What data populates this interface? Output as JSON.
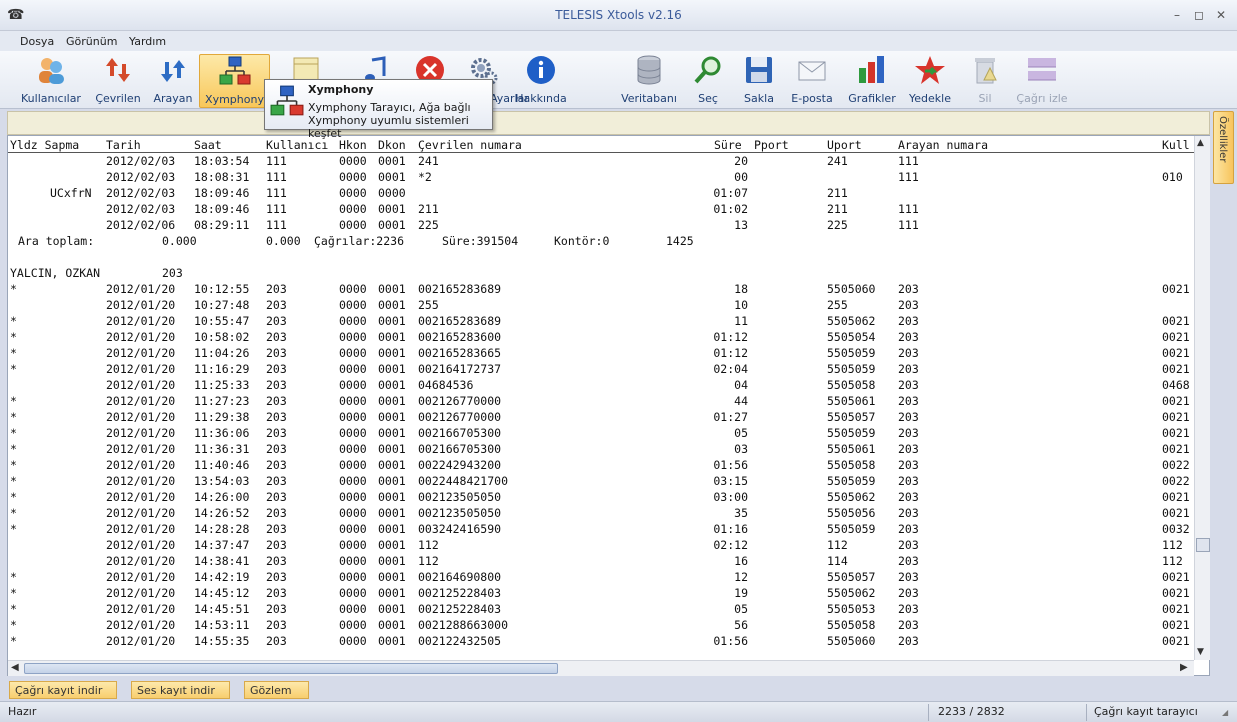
{
  "window": {
    "title": "TELESIS Xtools v2.16",
    "minimize": "–",
    "maximize": "◻",
    "close": "✕"
  },
  "menu": [
    "Dosya",
    "Görünüm",
    "Yardım"
  ],
  "toolbar": {
    "buttons": [
      {
        "label": "Kullanıcılar",
        "icon": "users-icon"
      },
      {
        "label": "Çevrilen",
        "icon": "dialed-arrows-icon"
      },
      {
        "label": "Arayan",
        "icon": "caller-arrows-icon"
      },
      {
        "label": "Xymphony",
        "icon": "network-tree-icon"
      },
      {
        "label": "Ayarlar",
        "icon": "gear-icon"
      },
      {
        "label": "Hakkında",
        "icon": "info-icon"
      },
      {
        "label": "Veritabanı",
        "icon": "database-icon"
      },
      {
        "label": "Seç",
        "icon": "magnifier-icon"
      },
      {
        "label": "Sakla",
        "icon": "floppy-icon"
      },
      {
        "label": "E-posta",
        "icon": "email-icon"
      },
      {
        "label": "Grafikler",
        "icon": "bar-chart-icon"
      },
      {
        "label": "Yedekle",
        "icon": "backup-star-icon"
      },
      {
        "label": "Sil",
        "icon": "trash-icon"
      },
      {
        "label": "Çağrı izle",
        "icon": "call-monitor-icon"
      }
    ]
  },
  "tooltip": {
    "title": "Xymphony",
    "line1": "Xymphony Tarayıcı, Ağa bağlı",
    "line2": "Xymphony uyumlu sistemleri keşfet"
  },
  "side_tab": "Özellikler",
  "table": {
    "headers": [
      "Yldz Sapma",
      "Tarih",
      "Saat",
      "Kullanıcı",
      "Hkon",
      "Dkon",
      "Çevrilen numara",
      "Süre",
      "Pport",
      "Uport",
      "Arayan numara",
      "Kull"
    ],
    "rows_top": [
      {
        "flag": "",
        "date": "2012/02/03",
        "time": "18:03:54",
        "user": "111",
        "hk": "0000",
        "dk": "0001",
        "num": "241",
        "dur": "20",
        "uport": "241",
        "caller": "111",
        "extra": ""
      },
      {
        "flag": "",
        "date": "2012/02/03",
        "time": "18:08:31",
        "user": "111",
        "hk": "0000",
        "dk": "0001",
        "num": "*2",
        "dur": "00",
        "uport": "",
        "caller": "111",
        "extra": "010"
      },
      {
        "flag": "UCxfrN",
        "date": "2012/02/03",
        "time": "18:09:46",
        "user": "111",
        "hk": "0000",
        "dk": "0000",
        "num": "",
        "dur": "01:07",
        "uport": "211",
        "caller": "",
        "extra": ""
      },
      {
        "flag": "",
        "date": "2012/02/03",
        "time": "18:09:46",
        "user": "111",
        "hk": "0000",
        "dk": "0001",
        "num": "211",
        "dur": "01:02",
        "uport": "211",
        "caller": "111",
        "extra": ""
      },
      {
        "flag": "",
        "date": "2012/02/06",
        "time": "08:29:11",
        "user": "111",
        "hk": "0000",
        "dk": "0001",
        "num": "225",
        "dur": "13",
        "uport": "225",
        "caller": "111",
        "extra": ""
      }
    ],
    "subtotal": {
      "label": "Ara toplam:",
      "v1": "0.000",
      "v2": "0.000",
      "calls": "Çağrılar:2236",
      "dur": "Süre:391504",
      "kontor": "Kontör:0",
      "n": "1425"
    },
    "group": {
      "name": "YALCIN, OZKAN",
      "ext": "203"
    },
    "rows": [
      {
        "flag": "*",
        "date": "2012/01/20",
        "time": "10:12:55",
        "num": "002165283689",
        "dur": "18",
        "uport": "5505060",
        "extra": "0021"
      },
      {
        "flag": "",
        "date": "2012/01/20",
        "time": "10:27:48",
        "num": "255",
        "dur": "10",
        "uport": "255",
        "extra": ""
      },
      {
        "flag": "*",
        "date": "2012/01/20",
        "time": "10:55:47",
        "num": "002165283689",
        "dur": "11",
        "uport": "5505062",
        "extra": "0021"
      },
      {
        "flag": "*",
        "date": "2012/01/20",
        "time": "10:58:02",
        "num": "002165283600",
        "dur": "01:12",
        "uport": "5505054",
        "extra": "0021"
      },
      {
        "flag": "*",
        "date": "2012/01/20",
        "time": "11:04:26",
        "num": "002165283665",
        "dur": "01:12",
        "uport": "5505059",
        "extra": "0021"
      },
      {
        "flag": "*",
        "date": "2012/01/20",
        "time": "11:16:29",
        "num": "002164172737",
        "dur": "02:04",
        "uport": "5505059",
        "extra": "0021"
      },
      {
        "flag": "",
        "date": "2012/01/20",
        "time": "11:25:33",
        "num": "04684536",
        "dur": "04",
        "uport": "5505058",
        "extra": "0468"
      },
      {
        "flag": "*",
        "date": "2012/01/20",
        "time": "11:27:23",
        "num": "002126770000",
        "dur": "44",
        "uport": "5505061",
        "extra": "0021"
      },
      {
        "flag": "*",
        "date": "2012/01/20",
        "time": "11:29:38",
        "num": "002126770000",
        "dur": "01:27",
        "uport": "5505057",
        "extra": "0021"
      },
      {
        "flag": "*",
        "date": "2012/01/20",
        "time": "11:36:06",
        "num": "002166705300",
        "dur": "05",
        "uport": "5505059",
        "extra": "0021"
      },
      {
        "flag": "*",
        "date": "2012/01/20",
        "time": "11:36:31",
        "num": "002166705300",
        "dur": "03",
        "uport": "5505061",
        "extra": "0021"
      },
      {
        "flag": "*",
        "date": "2012/01/20",
        "time": "11:40:46",
        "num": "002242943200",
        "dur": "01:56",
        "uport": "5505058",
        "extra": "0022"
      },
      {
        "flag": "*",
        "date": "2012/01/20",
        "time": "13:54:03",
        "num": "0022448421700",
        "dur": "03:15",
        "uport": "5505059",
        "extra": "0022"
      },
      {
        "flag": "*",
        "date": "2012/01/20",
        "time": "14:26:00",
        "num": "002123505050",
        "dur": "03:00",
        "uport": "5505062",
        "extra": "0021"
      },
      {
        "flag": "*",
        "date": "2012/01/20",
        "time": "14:26:52",
        "num": "002123505050",
        "dur": "35",
        "uport": "5505056",
        "extra": "0021"
      },
      {
        "flag": "*",
        "date": "2012/01/20",
        "time": "14:28:28",
        "num": "003242416590",
        "dur": "01:16",
        "uport": "5505059",
        "extra": "0032"
      },
      {
        "flag": "",
        "date": "2012/01/20",
        "time": "14:37:47",
        "num": "112",
        "dur": "02:12",
        "uport": "112",
        "extra": "112"
      },
      {
        "flag": "",
        "date": "2012/01/20",
        "time": "14:38:41",
        "num": "112",
        "dur": "16",
        "uport": "114",
        "extra": "112"
      },
      {
        "flag": "*",
        "date": "2012/01/20",
        "time": "14:42:19",
        "num": "002164690800",
        "dur": "12",
        "uport": "5505057",
        "extra": "0021"
      },
      {
        "flag": "*",
        "date": "2012/01/20",
        "time": "14:45:12",
        "num": "002125228403",
        "dur": "19",
        "uport": "5505062",
        "extra": "0021"
      },
      {
        "flag": "*",
        "date": "2012/01/20",
        "time": "14:45:51",
        "num": "002125228403",
        "dur": "05",
        "uport": "5505053",
        "extra": "0021"
      },
      {
        "flag": "*",
        "date": "2012/01/20",
        "time": "14:53:11",
        "num": "0021288663000",
        "dur": "56",
        "uport": "5505058",
        "extra": "0021"
      },
      {
        "flag": "*",
        "date": "2012/01/20",
        "time": "14:55:35",
        "num": "002122432505",
        "dur": "01:56",
        "uport": "5505060",
        "extra": "0021"
      }
    ],
    "group_user": "203",
    "hk": "0000",
    "dk": "0001"
  },
  "bottom_tabs": [
    "Çağrı kayıt indir",
    "Ses kayıt indir",
    "Gözlem"
  ],
  "status": {
    "left": "Hazır",
    "count": "2233 / 2832",
    "right": "Çağrı kayıt tarayıcı"
  }
}
